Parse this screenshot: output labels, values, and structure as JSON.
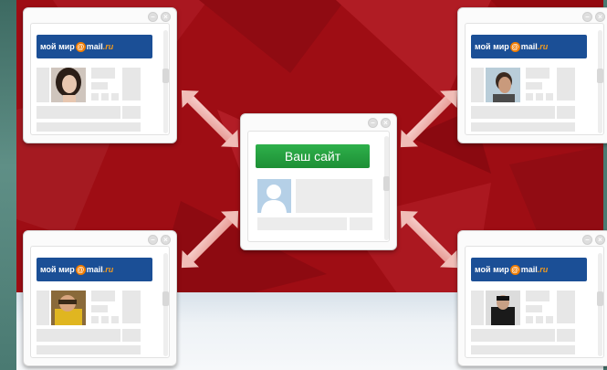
{
  "brand": {
    "prefix": "мой мир",
    "at": "@",
    "mail": "mail",
    "ru": ".ru"
  },
  "center": {
    "title": "Ваш сайт"
  },
  "windows": [
    {
      "avatar": "woman-with-dark-hair"
    },
    {
      "avatar": "man-profile"
    },
    {
      "avatar": "person-in-yellow-jacket"
    },
    {
      "avatar": "person-in-dark-jacket"
    }
  ],
  "colors": {
    "background_red": "#9e0d14",
    "banner_blue": "#1b4f96",
    "accent_orange": "#f07c00",
    "site_green": "#2eb04b",
    "avatar_placeholder": "#b5d0e7"
  },
  "icons": [
    "minimize-icon",
    "close-icon",
    "arrow-icon",
    "user-placeholder-icon"
  ]
}
